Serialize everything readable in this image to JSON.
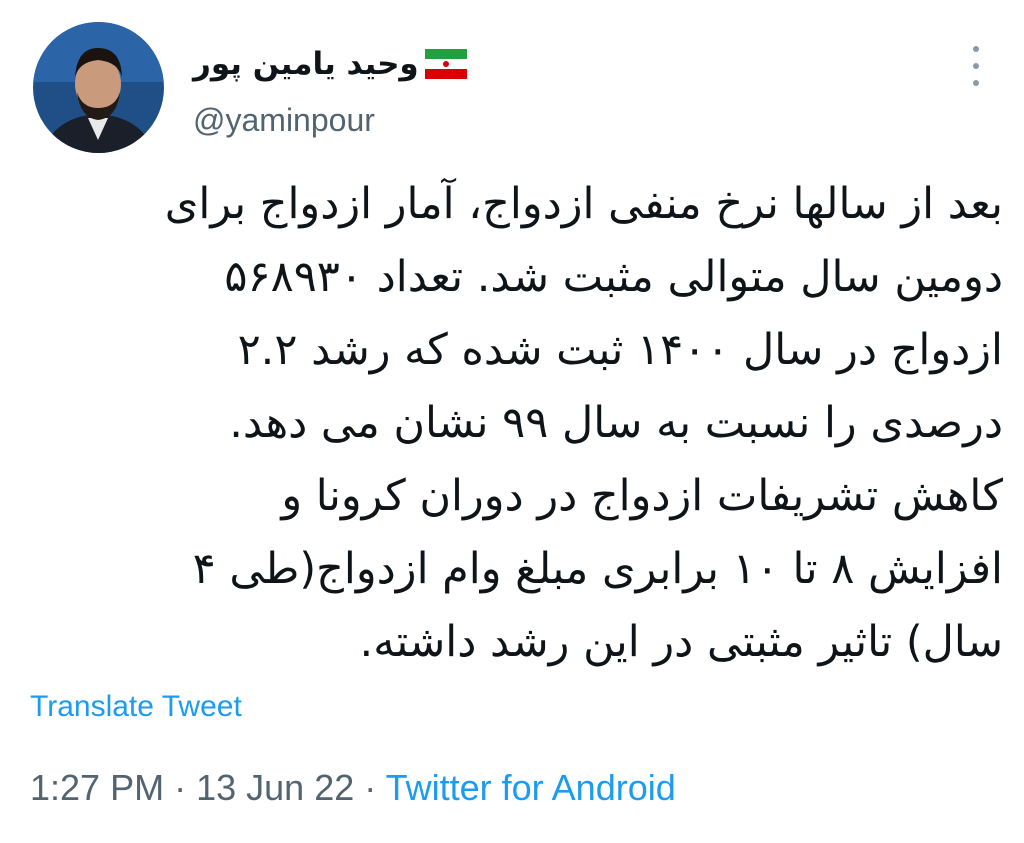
{
  "author": {
    "display_name": "وحید یامین پور",
    "handle": "@yaminpour",
    "avatar_icon": "profile-photo",
    "flag_icon": "iran-flag-icon"
  },
  "menu": {
    "icon": "more-vertical-icon"
  },
  "tweet": {
    "lines": [
      "بعد از سالها نرخ منفی ازدواج، آمار ازدواج برای",
      "دومین سال متوالی مثبت شد. تعداد ۵۶۸۹۳۰",
      "ازدواج در سال ۱۴۰۰ ثبت شده که رشد ۲.۲",
      "درصدی را نسبت به سال ۹۹ نشان می دهد.",
      "کاهش تشریفات ازدواج در دوران کرونا و",
      "افزایش ۸ تا ۱۰ برابری مبلغ وام ازدواج(طی ۴",
      "سال) تاثیر مثبتی در این رشد داشته."
    ]
  },
  "translate_label": "Translate Tweet",
  "meta": {
    "time": "1:27 PM",
    "separator": "·",
    "date": "13 Jun 22",
    "source": "Twitter for Android"
  },
  "colors": {
    "link": "#1d9bf0",
    "secondary_text": "#536471",
    "primary_text": "#0f1419"
  }
}
